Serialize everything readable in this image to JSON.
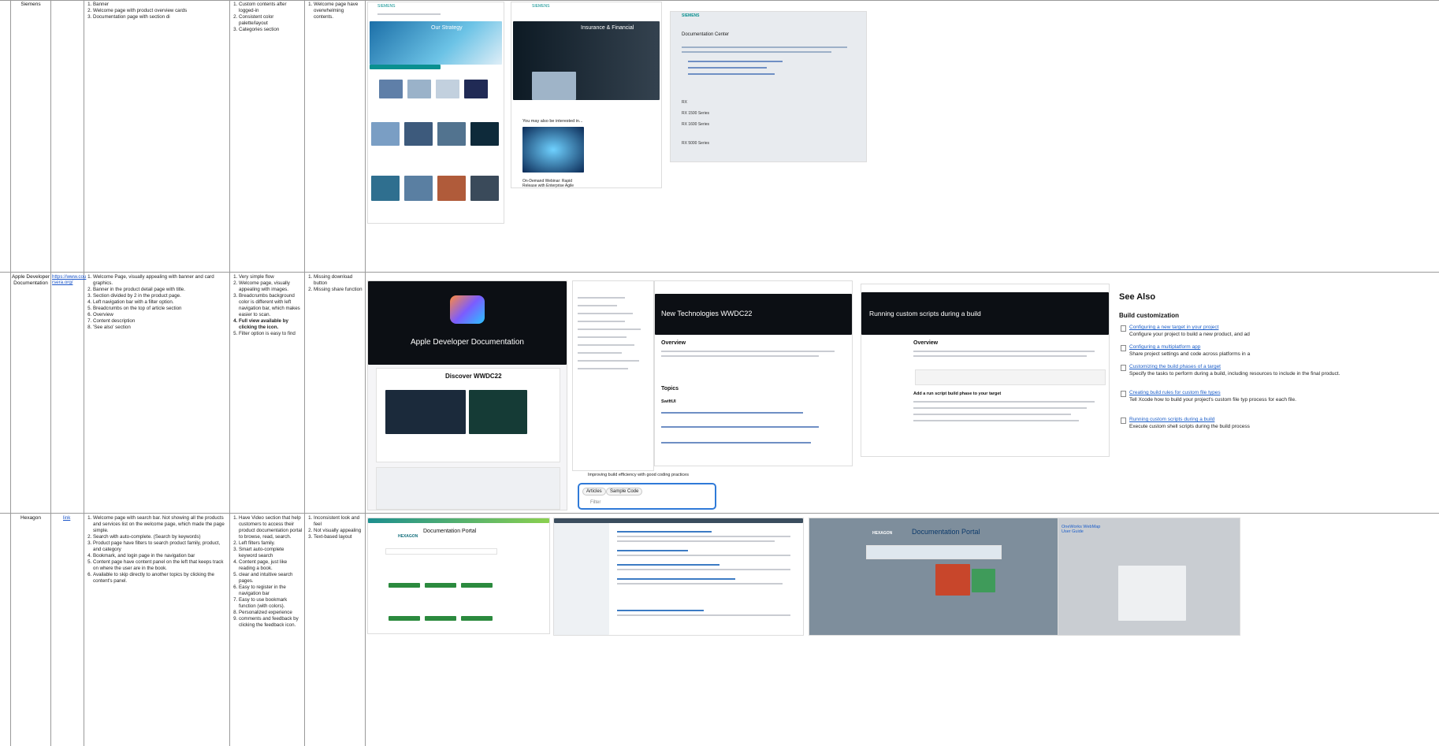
{
  "rows": [
    {
      "name": "Siemens",
      "link": "",
      "features": [
        "Banner",
        "Welcome page with product overview cards",
        "Documentation page with section di"
      ],
      "pros": [
        "Custom contents after logged-in",
        "Consistent color palette/layout",
        "Categories section"
      ],
      "cons": [
        "Welcome page have overwhelming contents."
      ]
    },
    {
      "name": "Apple Developer Documentation",
      "link": "https://www.cou rsera.org/",
      "features": [
        "Welcome Page, visually appealing with banner and card graphics.",
        "Banner in the product detail page with title.",
        "Section divided by 2 in the product page.",
        "Left navigation bar with a filter option.",
        "Breadcrumbs on the top of article section",
        "Overview",
        "Content description",
        "'See also' section"
      ],
      "pros": [
        "Very simple flow",
        "Welcome page, visually appealing with images.",
        "Breadcrumbs background color is different with left navigation bar, which makes easier to scan.",
        "Full view available by clicking the icon.",
        "Filter option is easy to find"
      ],
      "cons": [
        "Missing download button",
        "Missing share function"
      ]
    },
    {
      "name": "Hexagon",
      "link": "link",
      "features": [
        "Welcome page with search bar. Not showing all the products and services list on the welcome page, which made the page simple.",
        "Search with auto-complete. (Search by keywords)",
        "Product page have filters to search product family, product, and category",
        "Bookmark, and login page in the navigation bar",
        "Content page have content panel on the left that keeps track on where the user are in the book.",
        "Available to skip directly to another topics by clicking the content's panel."
      ],
      "pros": [
        "Have Video section that help customers to access their product documentation portal to browse, read, search.",
        "Left filters family.",
        "Smart auto-complete keyword search",
        "Content page, just like reading a book.",
        "clear and intuitive search pages.",
        "Easy to register in the navigation bar",
        "Easy to use bookmark function (with colors).",
        "Personalized experience",
        "comments and feedback by clicking the feedback icon."
      ],
      "cons": [
        "Inconsistent look and feel",
        "Not visually appealing",
        "Text-based layout"
      ]
    }
  ],
  "screens": {
    "siemens_logo": "SIEMENS",
    "siemens_strategy": "Our Strategy",
    "siemens_finance": "Insurance & Financial",
    "siemens_interest": "You may also be interested in...",
    "siemens_webinar": "On-Demand Webinar: Rapid Release with Enterprise Agile",
    "siemens_doc_center": "Documentation Center",
    "siemens_rx": "RX",
    "siemens_rx1": "RX 1500 Series",
    "siemens_rx2": "RX 1600 Series",
    "siemens_rx3": "RX 5000 Series",
    "apple_hero": "Apple Developer Documentation",
    "apple_discover": "Discover WWDC22",
    "apple_new_tech": "New Technologies WWDC22",
    "apple_overview": "Overview",
    "apple_topics": "Topics",
    "apple_swiftui": "SwiftUI",
    "apple_scripts": "Running custom scripts during a build",
    "apple_overview2": "Overview",
    "apple_add_script": "Add a run script build phase to your target",
    "apple_improve": "Improving build efficiency with good coding practices",
    "apple_chip_articles": "Articles",
    "apple_chip_sample": "Sample Code",
    "apple_filter": "Filter",
    "apple_see_also": "See Also",
    "apple_build_custom": "Build customization",
    "apple_links": [
      {
        "title": "Configuring a new target in your project",
        "desc": "Configure your project to build a new product, and ad"
      },
      {
        "title": "Configuring a multiplatform app",
        "desc": "Share project settings and code across platforms in a"
      },
      {
        "title": "Customizing the build phases of a target",
        "desc": "Specify the tasks to perform during a build, including resources to include in the final product."
      },
      {
        "title": "Creating build rules for custom file types",
        "desc": "Tell Xcode how to build your project's custom file typ process for each file."
      },
      {
        "title": "Running custom scripts during a build",
        "desc": "Execute custom shell scripts during the build process"
      }
    ],
    "hex_logo": "HEXAGON",
    "hex_portal": "Documentation Portal",
    "hex_portal2": "Documentation Portal",
    "hex_webview": "OneWorks WebMap User Guide"
  }
}
